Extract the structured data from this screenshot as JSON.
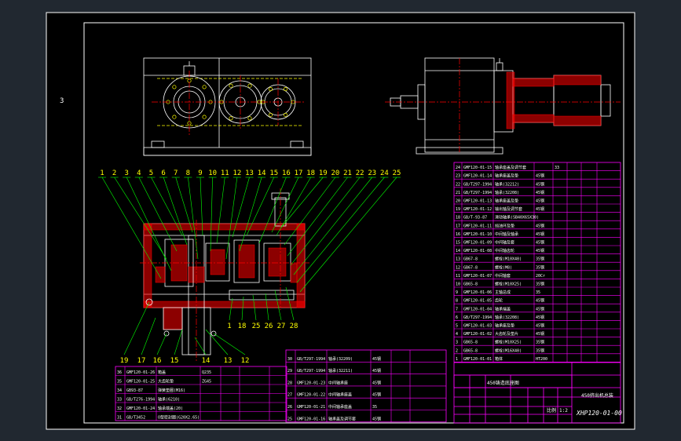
{
  "colors": {
    "background": "#212830",
    "sheet": "#000000",
    "frame": "#ffffff",
    "outline": "#ffffff",
    "centerline": "#ff0000",
    "hidden": "#ffff00",
    "leader": "#00ff00",
    "balloon": "#ffff00",
    "table": "#ff00ff",
    "hatch": "#ff0000",
    "text": "#ffffff"
  },
  "drawing": {
    "side_mark": "3",
    "top_callouts": [
      "1",
      "2",
      "3",
      "4",
      "5",
      "6",
      "7",
      "8",
      "9",
      "10",
      "11",
      "12",
      "13",
      "14",
      "15",
      "16",
      "17",
      "18",
      "19",
      "20",
      "21",
      "22",
      "23",
      "24",
      "25"
    ],
    "bottom_callouts_left": [
      "19",
      "17",
      "16",
      "15",
      "14",
      "13",
      "12"
    ],
    "bottom_callouts_right": [
      "1",
      "18",
      "25",
      "26",
      "27",
      "28"
    ],
    "drawing_number": "XHP120-01-00",
    "mid_title_cell": "450铸造底座图",
    "title_name": "450挤出机总装",
    "scale_label": "比例",
    "scale_value": "1:2"
  },
  "bom_right": [
    {
      "no": "24",
      "code": "GMF120-01-15",
      "name": "轴承座盖及调节套",
      "qty": "33",
      "mat": ""
    },
    {
      "no": "23",
      "code": "GMF120-01-14",
      "name": "轴承座盖及垫",
      "qty": "",
      "mat": "45钢"
    },
    {
      "no": "22",
      "code": "GB/T297-1994",
      "name": "轴承(32212)",
      "qty": "",
      "mat": "45钢"
    },
    {
      "no": "21",
      "code": "GB/T297-1994",
      "name": "轴承(32208)",
      "qty": "",
      "mat": "45钢"
    },
    {
      "no": "20",
      "code": "GMF120-01-13",
      "name": "轴承座盖及垫",
      "qty": "",
      "mat": "45钢"
    },
    {
      "no": "19",
      "code": "GMF120-01-12",
      "name": "输出轴及调节套",
      "qty": "",
      "mat": "45钢"
    },
    {
      "no": "18",
      "code": "GB/T-93-87",
      "name": "滑动轴承(SB40X65X30)",
      "qty": "",
      "mat": ""
    },
    {
      "no": "17",
      "code": "GMF120-01-11",
      "name": "挡油环及垫",
      "qty": "",
      "mat": "45钢"
    },
    {
      "no": "16",
      "code": "GMF120-01-10",
      "name": "中间轴及轴承",
      "qty": "",
      "mat": "45钢"
    },
    {
      "no": "15",
      "code": "GMF120-01-09",
      "name": "中间轴及套",
      "qty": "",
      "mat": "45钢"
    },
    {
      "no": "14",
      "code": "GMF120-01-08",
      "name": "中间轴齿轮",
      "qty": "",
      "mat": "45钢"
    },
    {
      "no": "13",
      "code": "GB67-8",
      "name": "螺栓(M10X40)",
      "qty": "",
      "mat": "35钢"
    },
    {
      "no": "12",
      "code": "GB67-8",
      "name": "螺栓(M8)",
      "qty": "",
      "mat": "35钢"
    },
    {
      "no": "11",
      "code": "GMF120-01-07",
      "name": "中间轴套",
      "qty": "",
      "mat": "20Cr"
    },
    {
      "no": "10",
      "code": "GB65-8",
      "name": "螺栓(M10X25)",
      "qty": "",
      "mat": "35钢"
    },
    {
      "no": "9",
      "code": "GMF120-01-06",
      "name": "主轴总成",
      "qty": "",
      "mat": "35"
    },
    {
      "no": "8",
      "code": "GMF120-01-05",
      "name": "齿轮",
      "qty": "",
      "mat": "45钢"
    },
    {
      "no": "7",
      "code": "GMF120-01-04",
      "name": "轴承端盖",
      "qty": "",
      "mat": "45钢"
    },
    {
      "no": "6",
      "code": "GB/T297-1994",
      "name": "轴承(32208)",
      "qty": "",
      "mat": "45钢"
    },
    {
      "no": "5",
      "code": "GMF120-01-03",
      "name": "轴承座及垫",
      "qty": "",
      "mat": "45钢"
    },
    {
      "no": "4",
      "code": "GMF120-01-02",
      "name": "大齿轮及垫片",
      "qty": "",
      "mat": "45钢"
    },
    {
      "no": "3",
      "code": "GB65-8",
      "name": "螺栓(M10X25)",
      "qty": "",
      "mat": "35钢"
    },
    {
      "no": "2",
      "code": "GB65-8",
      "name": "螺栓(M16X40)",
      "qty": "",
      "mat": "35钢"
    },
    {
      "no": "1",
      "code": "GMF120-01-01",
      "name": "箱体",
      "qty": "",
      "mat": "HT200"
    }
  ],
  "bom_bottom_left": [
    {
      "no": "36",
      "code": "GMF120-01-26",
      "name": "箱盖",
      "qty": "Q235"
    },
    {
      "no": "35",
      "code": "GMF120-01-25",
      "name": "大齿轮垫",
      "qty": "ZG45"
    },
    {
      "no": "34",
      "code": "GB93-87",
      "name": "弹簧垫圈(M16)",
      "qty": ""
    },
    {
      "no": "33",
      "code": "GB/T276-1994",
      "name": "轴承(6210)",
      "qty": ""
    },
    {
      "no": "32",
      "code": "GMF120-01-24",
      "name": "轴承端盖(20)",
      "qty": ""
    },
    {
      "no": "31",
      "code": "GB/T3452",
      "name": "O型密封圈(G20X2.65)",
      "qty": ""
    }
  ],
  "bom_bottom_mid": [
    {
      "no": "30",
      "code": "GB/T297-1994",
      "name": "轴承(32209)",
      "mat": "45钢"
    },
    {
      "no": "29",
      "code": "GB/T297-1994",
      "name": "轴承(32211)",
      "mat": "45钢"
    },
    {
      "no": "28",
      "code": "GMF120-01-23",
      "name": "中间轴承座",
      "mat": "45钢"
    },
    {
      "no": "27",
      "code": "GMF120-01-22",
      "name": "中间轴承座盖",
      "mat": "45钢"
    },
    {
      "no": "26",
      "code": "GMF120-01-21",
      "name": "中间轴承座盖",
      "mat": "35"
    },
    {
      "no": "25",
      "code": "GMF120-01-16",
      "name": "轴承盖及调节套",
      "mat": "45钢"
    }
  ]
}
